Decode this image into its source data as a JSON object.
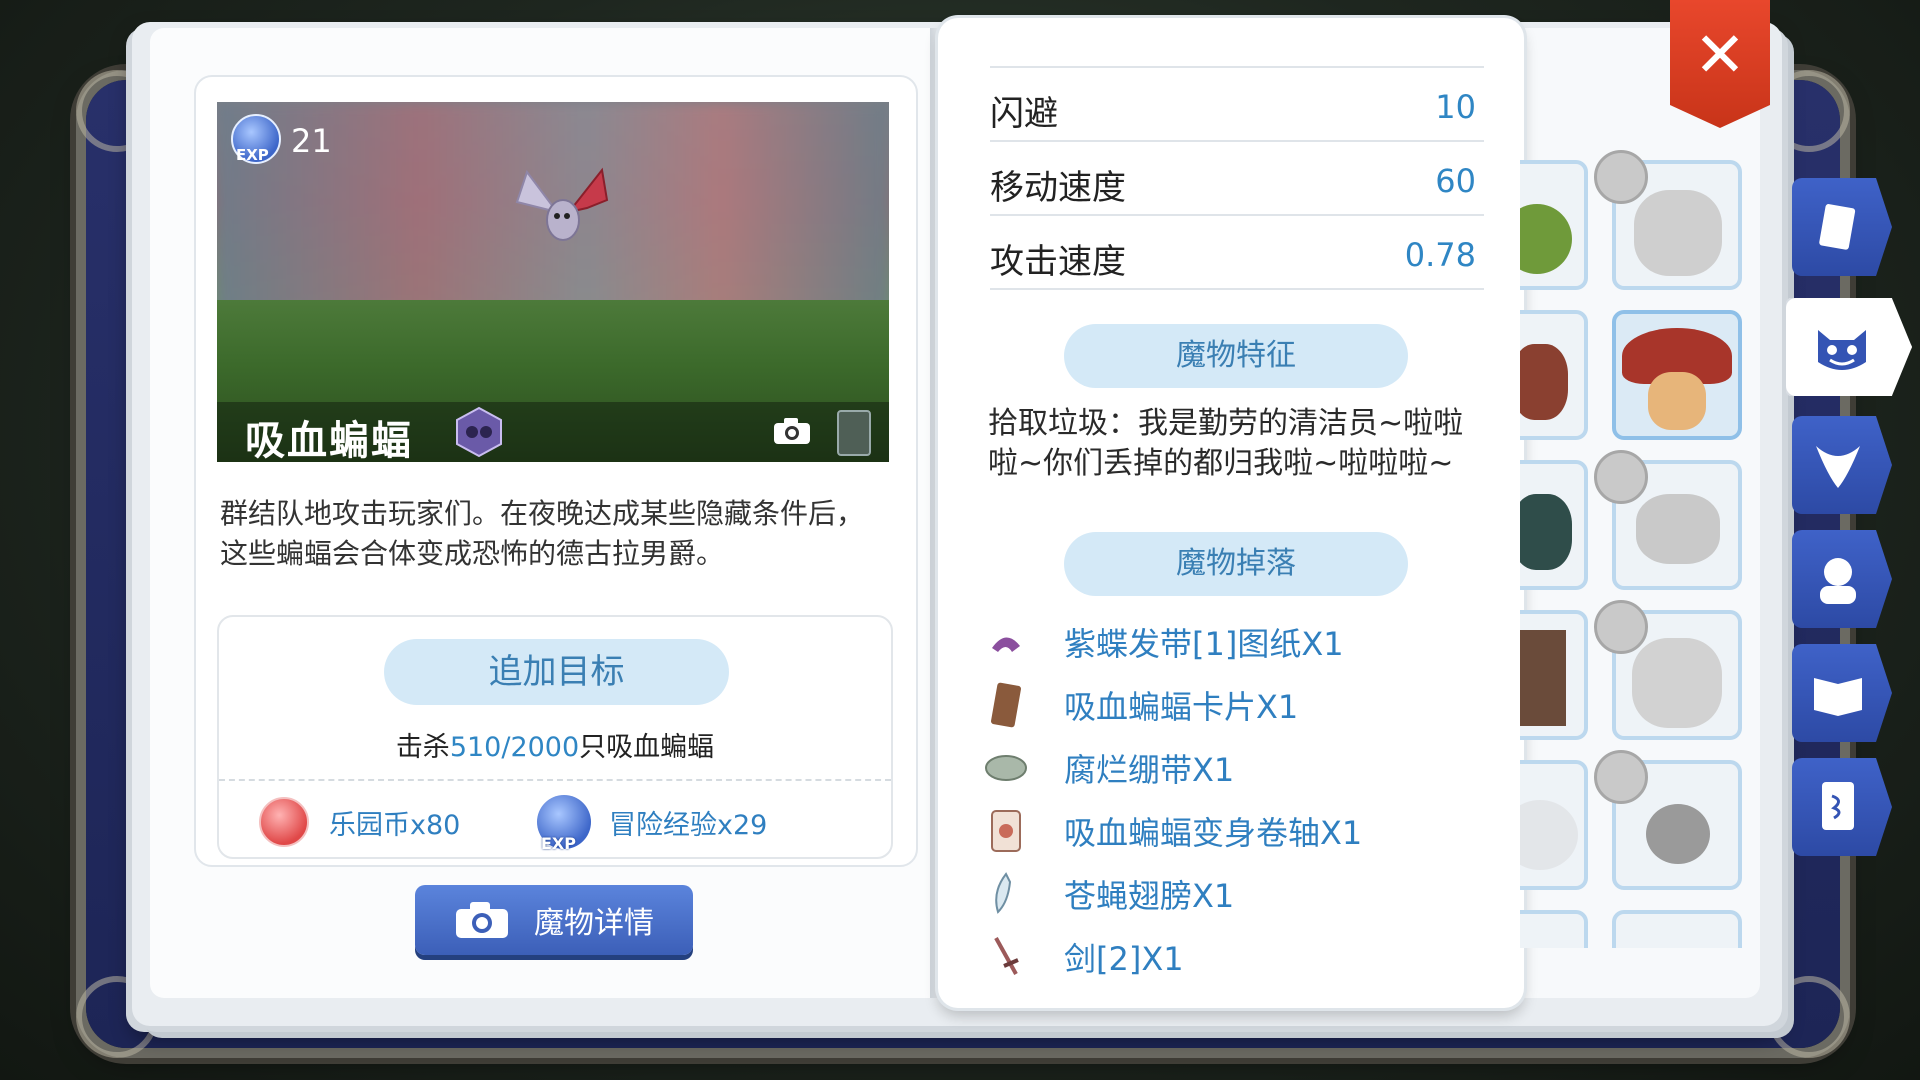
{
  "monster": {
    "exp_label": "EXP",
    "exp_value": "21",
    "name": "吸血蝙蝠",
    "description": "群结队地攻击玩家们。在夜晚达成某些隐藏条件后，这些蝙蝠会合体变成恐怖的德古拉男爵。"
  },
  "target": {
    "add_button": "追加目标",
    "kill_prefix": "击杀",
    "kill_progress": "510/2000",
    "kill_suffix": "只吸血蝙蝠",
    "rewards": [
      {
        "label": "乐园币x80",
        "icon": "coin-icon"
      },
      {
        "label": "冒险经验x29",
        "icon": "exp-icon",
        "icon_text": "EXP"
      }
    ]
  },
  "detail_button": "魔物详情",
  "stats": [
    {
      "label": "闪避",
      "value": "10"
    },
    {
      "label": "移动速度",
      "value": "60"
    },
    {
      "label": "攻击速度",
      "value": "0.78"
    }
  ],
  "features": {
    "title": "魔物特征",
    "text": "拾取垃圾：我是勤劳的清洁员~啦啦啦~你们丢掉的都归我啦~啦啦啦~"
  },
  "drops": {
    "title": "魔物掉落",
    "items": [
      {
        "name": "紫蝶发带[1]图纸X1",
        "icon": "hairband-icon"
      },
      {
        "name": "吸血蝙蝠卡片X1",
        "icon": "card-icon"
      },
      {
        "name": "腐烂绷带X1",
        "icon": "bandage-icon"
      },
      {
        "name": "吸血蝙蝠变身卷轴X1",
        "icon": "scroll-icon"
      },
      {
        "name": "苍蝇翅膀X1",
        "icon": "wing-icon"
      },
      {
        "name": "剑[2]X1",
        "icon": "sword-icon"
      }
    ]
  },
  "close_label": "✕",
  "colors": {
    "accent": "#2f86c4",
    "pill": "#d4e9f7",
    "tab": "#3f62c8",
    "close": "#d93c20"
  }
}
